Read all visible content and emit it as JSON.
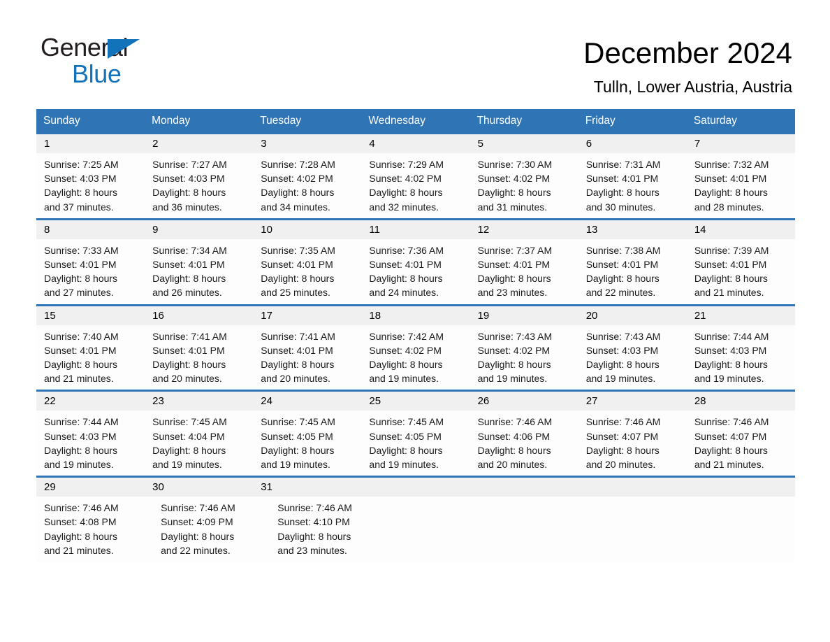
{
  "brand": {
    "name_part1": "General",
    "name_part2": "Blue",
    "accent_color": "#1272ba"
  },
  "header": {
    "title": "December 2024",
    "location": "Tulln, Lower Austria, Austria"
  },
  "calendar": {
    "header_color": "#2f74b5",
    "weekdays": [
      "Sunday",
      "Monday",
      "Tuesday",
      "Wednesday",
      "Thursday",
      "Friday",
      "Saturday"
    ],
    "weeks": [
      [
        {
          "day": "1",
          "sunrise": "Sunrise: 7:25 AM",
          "sunset": "Sunset: 4:03 PM",
          "daylight1": "Daylight: 8 hours",
          "daylight2": "and 37 minutes."
        },
        {
          "day": "2",
          "sunrise": "Sunrise: 7:27 AM",
          "sunset": "Sunset: 4:03 PM",
          "daylight1": "Daylight: 8 hours",
          "daylight2": "and 36 minutes."
        },
        {
          "day": "3",
          "sunrise": "Sunrise: 7:28 AM",
          "sunset": "Sunset: 4:02 PM",
          "daylight1": "Daylight: 8 hours",
          "daylight2": "and 34 minutes."
        },
        {
          "day": "4",
          "sunrise": "Sunrise: 7:29 AM",
          "sunset": "Sunset: 4:02 PM",
          "daylight1": "Daylight: 8 hours",
          "daylight2": "and 32 minutes."
        },
        {
          "day": "5",
          "sunrise": "Sunrise: 7:30 AM",
          "sunset": "Sunset: 4:02 PM",
          "daylight1": "Daylight: 8 hours",
          "daylight2": "and 31 minutes."
        },
        {
          "day": "6",
          "sunrise": "Sunrise: 7:31 AM",
          "sunset": "Sunset: 4:01 PM",
          "daylight1": "Daylight: 8 hours",
          "daylight2": "and 30 minutes."
        },
        {
          "day": "7",
          "sunrise": "Sunrise: 7:32 AM",
          "sunset": "Sunset: 4:01 PM",
          "daylight1": "Daylight: 8 hours",
          "daylight2": "and 28 minutes."
        }
      ],
      [
        {
          "day": "8",
          "sunrise": "Sunrise: 7:33 AM",
          "sunset": "Sunset: 4:01 PM",
          "daylight1": "Daylight: 8 hours",
          "daylight2": "and 27 minutes."
        },
        {
          "day": "9",
          "sunrise": "Sunrise: 7:34 AM",
          "sunset": "Sunset: 4:01 PM",
          "daylight1": "Daylight: 8 hours",
          "daylight2": "and 26 minutes."
        },
        {
          "day": "10",
          "sunrise": "Sunrise: 7:35 AM",
          "sunset": "Sunset: 4:01 PM",
          "daylight1": "Daylight: 8 hours",
          "daylight2": "and 25 minutes."
        },
        {
          "day": "11",
          "sunrise": "Sunrise: 7:36 AM",
          "sunset": "Sunset: 4:01 PM",
          "daylight1": "Daylight: 8 hours",
          "daylight2": "and 24 minutes."
        },
        {
          "day": "12",
          "sunrise": "Sunrise: 7:37 AM",
          "sunset": "Sunset: 4:01 PM",
          "daylight1": "Daylight: 8 hours",
          "daylight2": "and 23 minutes."
        },
        {
          "day": "13",
          "sunrise": "Sunrise: 7:38 AM",
          "sunset": "Sunset: 4:01 PM",
          "daylight1": "Daylight: 8 hours",
          "daylight2": "and 22 minutes."
        },
        {
          "day": "14",
          "sunrise": "Sunrise: 7:39 AM",
          "sunset": "Sunset: 4:01 PM",
          "daylight1": "Daylight: 8 hours",
          "daylight2": "and 21 minutes."
        }
      ],
      [
        {
          "day": "15",
          "sunrise": "Sunrise: 7:40 AM",
          "sunset": "Sunset: 4:01 PM",
          "daylight1": "Daylight: 8 hours",
          "daylight2": "and 21 minutes."
        },
        {
          "day": "16",
          "sunrise": "Sunrise: 7:41 AM",
          "sunset": "Sunset: 4:01 PM",
          "daylight1": "Daylight: 8 hours",
          "daylight2": "and 20 minutes."
        },
        {
          "day": "17",
          "sunrise": "Sunrise: 7:41 AM",
          "sunset": "Sunset: 4:01 PM",
          "daylight1": "Daylight: 8 hours",
          "daylight2": "and 20 minutes."
        },
        {
          "day": "18",
          "sunrise": "Sunrise: 7:42 AM",
          "sunset": "Sunset: 4:02 PM",
          "daylight1": "Daylight: 8 hours",
          "daylight2": "and 19 minutes."
        },
        {
          "day": "19",
          "sunrise": "Sunrise: 7:43 AM",
          "sunset": "Sunset: 4:02 PM",
          "daylight1": "Daylight: 8 hours",
          "daylight2": "and 19 minutes."
        },
        {
          "day": "20",
          "sunrise": "Sunrise: 7:43 AM",
          "sunset": "Sunset: 4:03 PM",
          "daylight1": "Daylight: 8 hours",
          "daylight2": "and 19 minutes."
        },
        {
          "day": "21",
          "sunrise": "Sunrise: 7:44 AM",
          "sunset": "Sunset: 4:03 PM",
          "daylight1": "Daylight: 8 hours",
          "daylight2": "and 19 minutes."
        }
      ],
      [
        {
          "day": "22",
          "sunrise": "Sunrise: 7:44 AM",
          "sunset": "Sunset: 4:03 PM",
          "daylight1": "Daylight: 8 hours",
          "daylight2": "and 19 minutes."
        },
        {
          "day": "23",
          "sunrise": "Sunrise: 7:45 AM",
          "sunset": "Sunset: 4:04 PM",
          "daylight1": "Daylight: 8 hours",
          "daylight2": "and 19 minutes."
        },
        {
          "day": "24",
          "sunrise": "Sunrise: 7:45 AM",
          "sunset": "Sunset: 4:05 PM",
          "daylight1": "Daylight: 8 hours",
          "daylight2": "and 19 minutes."
        },
        {
          "day": "25",
          "sunrise": "Sunrise: 7:45 AM",
          "sunset": "Sunset: 4:05 PM",
          "daylight1": "Daylight: 8 hours",
          "daylight2": "and 19 minutes."
        },
        {
          "day": "26",
          "sunrise": "Sunrise: 7:46 AM",
          "sunset": "Sunset: 4:06 PM",
          "daylight1": "Daylight: 8 hours",
          "daylight2": "and 20 minutes."
        },
        {
          "day": "27",
          "sunrise": "Sunrise: 7:46 AM",
          "sunset": "Sunset: 4:07 PM",
          "daylight1": "Daylight: 8 hours",
          "daylight2": "and 20 minutes."
        },
        {
          "day": "28",
          "sunrise": "Sunrise: 7:46 AM",
          "sunset": "Sunset: 4:07 PM",
          "daylight1": "Daylight: 8 hours",
          "daylight2": "and 21 minutes."
        }
      ],
      [
        {
          "day": "29",
          "sunrise": "Sunrise: 7:46 AM",
          "sunset": "Sunset: 4:08 PM",
          "daylight1": "Daylight: 8 hours",
          "daylight2": "and 21 minutes."
        },
        {
          "day": "30",
          "sunrise": "Sunrise: 7:46 AM",
          "sunset": "Sunset: 4:09 PM",
          "daylight1": "Daylight: 8 hours",
          "daylight2": "and 22 minutes."
        },
        {
          "day": "31",
          "sunrise": "Sunrise: 7:46 AM",
          "sunset": "Sunset: 4:10 PM",
          "daylight1": "Daylight: 8 hours",
          "daylight2": "and 23 minutes."
        },
        {
          "day": "",
          "sunrise": "",
          "sunset": "",
          "daylight1": "",
          "daylight2": ""
        },
        {
          "day": "",
          "sunrise": "",
          "sunset": "",
          "daylight1": "",
          "daylight2": ""
        },
        {
          "day": "",
          "sunrise": "",
          "sunset": "",
          "daylight1": "",
          "daylight2": ""
        },
        {
          "day": "",
          "sunrise": "",
          "sunset": "",
          "daylight1": "",
          "daylight2": ""
        }
      ]
    ]
  }
}
